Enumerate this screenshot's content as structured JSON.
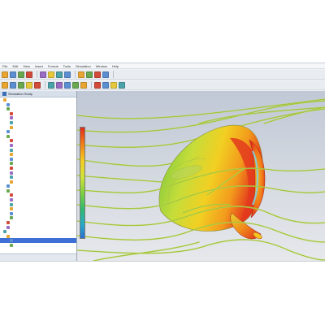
{
  "menubar": {
    "items": [
      "File",
      "Edit",
      "View",
      "Insert",
      "Format",
      "Tools",
      "Simulation",
      "Window",
      "Help"
    ]
  },
  "toolbars": {
    "row1": [
      "#e8a631",
      "#5b8fd1",
      "#6aa84f",
      "#d24b3a",
      "#9a6bc4",
      "#e6c93b",
      "#4aa3a8",
      "#5b8fd1",
      "#e8a631",
      "#6aa84f",
      "#d24b3a",
      "#5b8fd1"
    ],
    "row2": [
      "#e8a631",
      "#5b8fd1",
      "#6aa84f",
      "#e6c93b",
      "#d24b3a",
      "#4aa3a8",
      "#9a6bc4",
      "#5b8fd1",
      "#6aa84f",
      "#e8a631",
      "#d24b3a",
      "#5b8fd1",
      "#e6c93b",
      "#4aa3a8"
    ]
  },
  "tree": {
    "title": "Simulation Study",
    "rows": [
      "",
      "",
      "",
      "",
      "",
      "",
      "",
      "",
      "",
      "",
      "",
      "",
      "",
      "",
      "",
      "",
      "",
      "",
      "",
      "",
      "",
      "",
      "",
      "",
      "",
      "",
      "",
      "",
      "",
      "",
      "",
      "",
      ""
    ]
  },
  "colors": {
    "accent": "#3d6fd6",
    "surface_hot": "#e02a1c",
    "surface_mid": "#f4cc1f",
    "surface_cool": "#79cf3f",
    "streamline": "#b9d84a"
  }
}
